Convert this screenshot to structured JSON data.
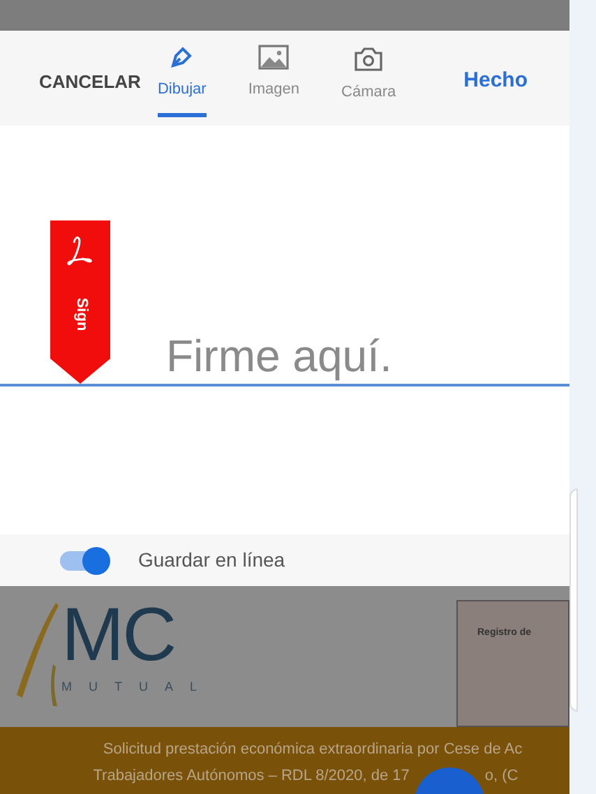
{
  "toolbar": {
    "cancel": "CANCELAR",
    "done": "Hecho",
    "tabs": [
      {
        "label": "Dibujar",
        "kind": "pen",
        "selected": true
      },
      {
        "label": "Imagen",
        "kind": "image",
        "selected": false
      },
      {
        "label": "Cámara",
        "kind": "camera",
        "selected": false
      }
    ]
  },
  "signature": {
    "tag": "Sign",
    "placeholder": "Firme aquí."
  },
  "save_online": {
    "label": "Guardar en línea",
    "on": true
  },
  "document": {
    "logo": "MC",
    "logo_sub": "MUTUAL",
    "registry": "Registro de",
    "banner_line_1": "Solicitud prestación económica extraordinaria por Cese de Ac",
    "banner_line_2a": "Trabajadores Autónomos – RDL 8/2020, de 17",
    "banner_line_2b": "o, (C"
  }
}
